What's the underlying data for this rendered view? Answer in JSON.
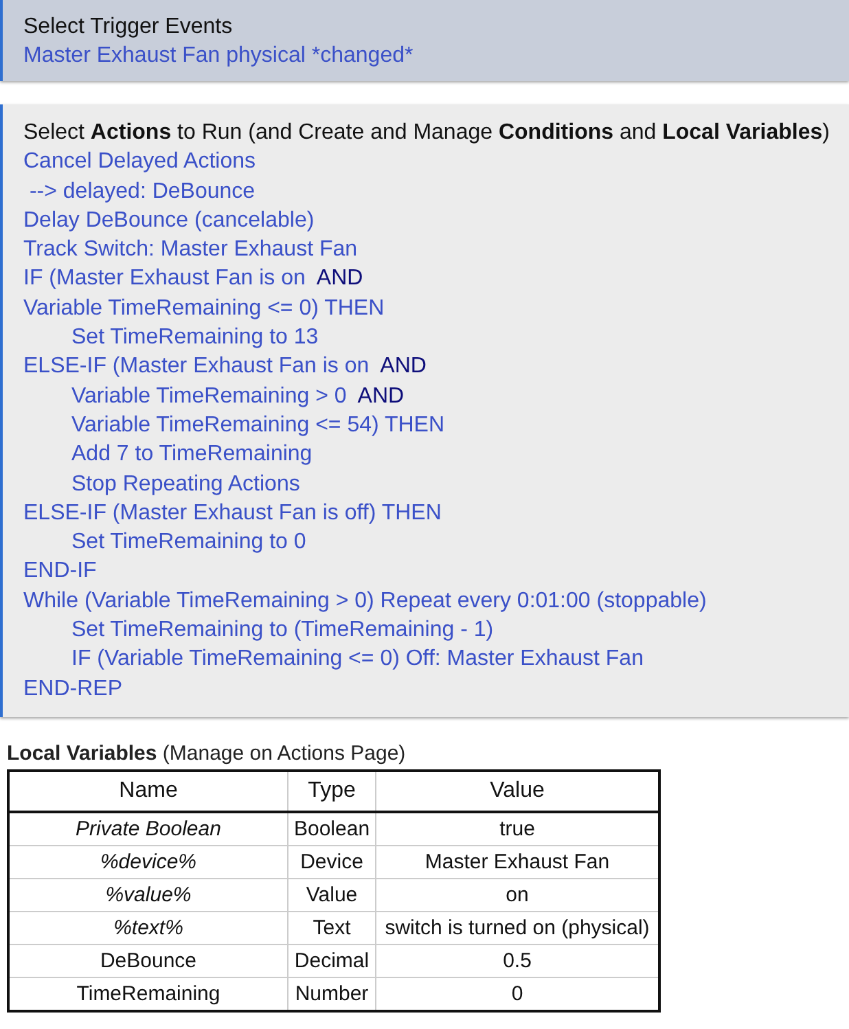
{
  "trigger_panel": {
    "title": "Select Trigger Events",
    "events": [
      "Master Exhaust Fan physical *changed*"
    ]
  },
  "actions_panel": {
    "title": "Select **Actions** to Run (and Create and Manage **Conditions** and **Local Variables**)",
    "lines": [
      {
        "kind": "top",
        "text": "Cancel Delayed Actions"
      },
      {
        "kind": "top",
        "text": " --> delayed: DeBounce"
      },
      {
        "kind": "top",
        "text": "Delay DeBounce (cancelable)"
      },
      {
        "kind": "top",
        "text": "Track Switch: Master Exhaust Fan"
      },
      {
        "kind": "top",
        "text": "IF (Master Exhaust Fan is on",
        "connector": "AND"
      },
      {
        "kind": "top",
        "text": "Variable TimeRemaining <= 0) THEN"
      },
      {
        "kind": "nested",
        "text": "Set TimeRemaining to 13"
      },
      {
        "kind": "top",
        "text": "ELSE-IF (Master Exhaust Fan is on",
        "connector": "AND"
      },
      {
        "kind": "nested",
        "text": "Variable TimeRemaining > 0",
        "connector": "AND"
      },
      {
        "kind": "nested",
        "text": "Variable TimeRemaining <= 54) THEN"
      },
      {
        "kind": "nested",
        "text": "Add 7 to TimeRemaining"
      },
      {
        "kind": "nested",
        "text": "Stop Repeating Actions"
      },
      {
        "kind": "top",
        "text": "ELSE-IF (Master Exhaust Fan is off) THEN"
      },
      {
        "kind": "nested",
        "text": "Set TimeRemaining to 0"
      },
      {
        "kind": "top",
        "text": "END-IF"
      },
      {
        "kind": "top",
        "text": "While (Variable TimeRemaining > 0) Repeat every 0:01:00 (stoppable)"
      },
      {
        "kind": "nested",
        "text": "Set TimeRemaining to (TimeRemaining - 1)"
      },
      {
        "kind": "nested",
        "text": "IF (Variable TimeRemaining <= 0) Off: Master Exhaust Fan"
      },
      {
        "kind": "top",
        "text": "END-REP"
      }
    ]
  },
  "local_variables": {
    "title": "**Local Variables** (Manage on Actions Page)",
    "columns": [
      "Name",
      "Type",
      "Value"
    ],
    "rows": [
      {
        "kind": "builtin",
        "name": "Private Boolean",
        "type": "Boolean",
        "value": "true"
      },
      {
        "kind": "builtin",
        "name": "%device%",
        "type": "Device",
        "value": "Master Exhaust Fan"
      },
      {
        "kind": "builtin",
        "name": "%value%",
        "type": "Value",
        "value": "on"
      },
      {
        "kind": "builtin",
        "name": "%text%",
        "type": "Text",
        "value": "switch is turned on (physical)"
      },
      {
        "kind": "user",
        "name": "DeBounce",
        "type": "Decimal",
        "value": "0.5"
      },
      {
        "kind": "user",
        "name": "TimeRemaining",
        "type": "Number",
        "value": "0"
      }
    ]
  }
}
